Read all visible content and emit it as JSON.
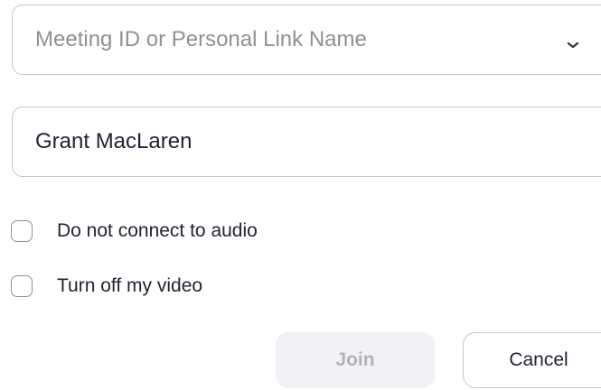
{
  "meeting_id": {
    "placeholder": "Meeting ID or Personal Link Name",
    "value": "",
    "dropdown_icon": "chevron-down-icon"
  },
  "display_name": {
    "value": "Grant MacLaren"
  },
  "options": {
    "audio": {
      "label": "Do not connect to audio",
      "checked": false
    },
    "video": {
      "label": "Turn off my video",
      "checked": false
    }
  },
  "buttons": {
    "join_label": "Join",
    "join_enabled": false,
    "cancel_label": "Cancel"
  },
  "colors": {
    "text": "#232333",
    "placeholder": "#909096",
    "border": "#c8c8cf",
    "join_bg_disabled": "#f2f2f6",
    "join_text_disabled": "#b2b2b8"
  }
}
